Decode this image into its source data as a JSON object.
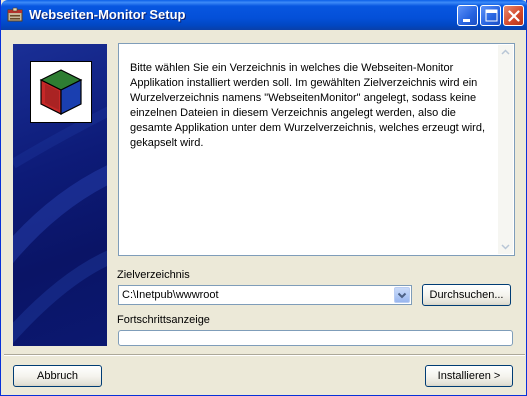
{
  "window": {
    "title": "Webseiten-Monitor Setup",
    "accent_color": "#0A5FE8",
    "title_icon": "setup-installer-icon"
  },
  "titlebar_buttons": {
    "minimize_icon": "minimize-icon",
    "maximize_icon": "maximize-icon",
    "close_icon": "close-icon"
  },
  "info": {
    "text": "Bitte wählen Sie ein Verzeichnis in welches die Webseiten-Monitor Applikation installiert werden soll. Im gewählten Zielverzeichnis wird ein Wurzelverzeichnis namens \"WebseitenMonitor\" angelegt, sodass keine einzelnen Dateien in diesem Verzeichnis angelegt werden, also die gesamte Applikation unter dem Wurzelverzeichnis, welches erzeugt wird, gekapselt wird."
  },
  "target": {
    "label": "Zielverzeichnis",
    "value": "C:\\Inetpub\\wwwroot",
    "browse_label": "Durchsuchen..."
  },
  "progress": {
    "label": "Fortschrittsanzeige",
    "value_percent": 0
  },
  "footer": {
    "cancel_label": "Abbruch",
    "install_label": "Installieren >"
  },
  "logo": {
    "icon": "package-box-icon"
  }
}
